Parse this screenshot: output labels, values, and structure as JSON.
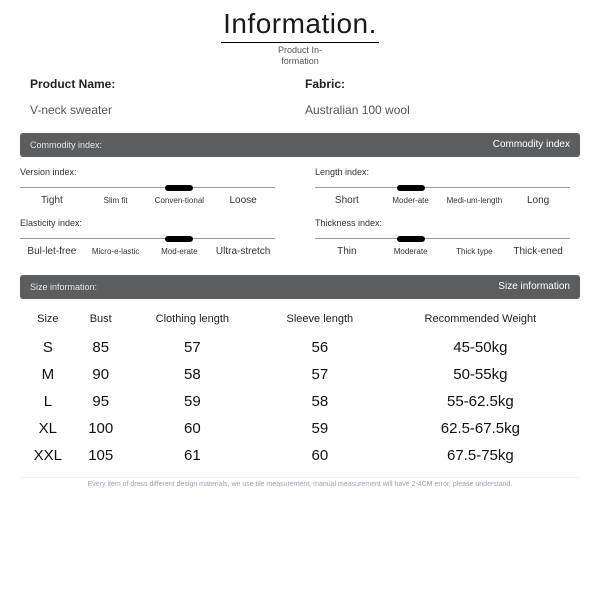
{
  "header": {
    "title": "Information.",
    "subtitle": "Product In-formation"
  },
  "product": {
    "name_label": "Product Name:",
    "name_value": "V-neck sweater",
    "fabric_label": "Fabric:",
    "fabric_value": "Australian 100 wool"
  },
  "bars": {
    "commodity_left": "Commodity index:",
    "commodity_right": "Commodity index",
    "size_left": "Size information:",
    "size_right": "Size information"
  },
  "indices": {
    "version": {
      "label": "Version index:",
      "opts": [
        "Tight",
        "Slim fit",
        "Conven-tional",
        "Loose"
      ],
      "selected": 2
    },
    "length": {
      "label": "Length index:",
      "opts": [
        "Short",
        "Moder-ate",
        "Medi-um-length",
        "Long"
      ],
      "selected": 1
    },
    "elasticity": {
      "label": "Elasticity index:",
      "opts": [
        "Bul-let-free",
        "Micro-e-lastic",
        "Mod-erate",
        "Ultra-stretch"
      ],
      "selected": 2
    },
    "thickness": {
      "label": "Thickness index:",
      "opts": [
        "Thin",
        "Moderate",
        "Thick type",
        "Thick-ened"
      ],
      "selected": 1
    }
  },
  "chart_data": {
    "type": "table",
    "title": "Size information",
    "columns": [
      "Size",
      "Bust",
      "Clothing length",
      "Sleeve length",
      "Recommended Weight"
    ],
    "rows": [
      [
        "S",
        "85",
        "57",
        "56",
        "45-50kg"
      ],
      [
        "M",
        "90",
        "58",
        "57",
        "50-55kg"
      ],
      [
        "L",
        "95",
        "59",
        "58",
        "55-62.5kg"
      ],
      [
        "XL",
        "100",
        "60",
        "59",
        "62.5-67.5kg"
      ],
      [
        "XXL",
        "105",
        "61",
        "60",
        "67.5-75kg"
      ]
    ]
  },
  "footnote": "Every item of dress different design materials, we use tile measurement, manual measurement will have 2-4CM error, please understand."
}
